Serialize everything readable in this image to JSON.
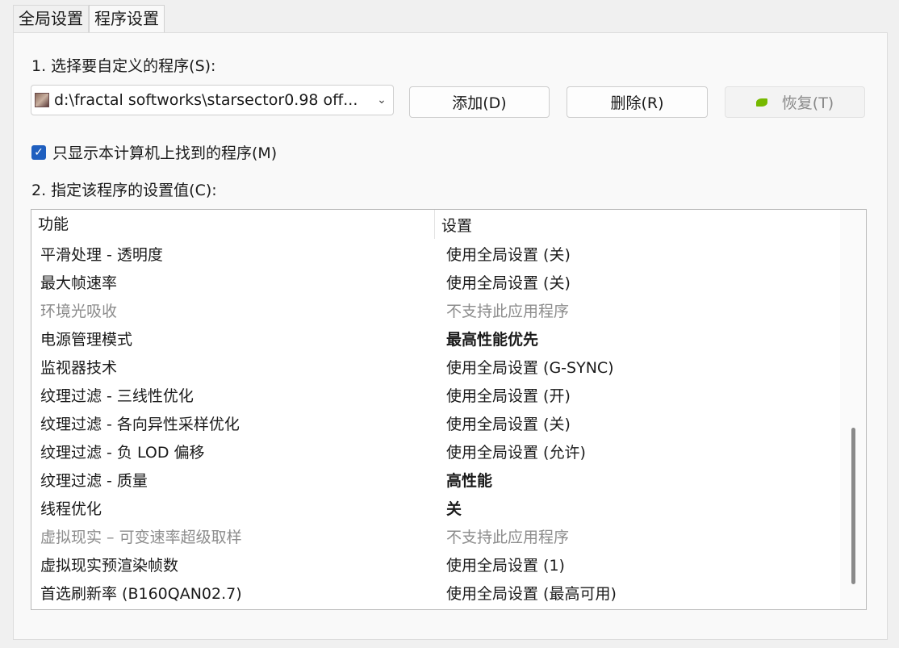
{
  "tabs": [
    {
      "label": "全局设置"
    },
    {
      "label": "程序设置"
    }
  ],
  "step1_label": "1. 选择要自定义的程序(S):",
  "program_select": {
    "value": "d:\\fractal softworks\\starsector0.98 off..."
  },
  "buttons": {
    "add": "添加(D)",
    "delete": "删除(R)",
    "restore": "恢复(T)"
  },
  "checkbox": {
    "label": "只显示本计算机上找到的程序(M)",
    "checked": true
  },
  "step2_label": "2. 指定该程序的设置值(C):",
  "table": {
    "headers": [
      "功能",
      "设置"
    ],
    "rows": [
      {
        "feature": "平滑处理 - 透明度",
        "setting": "使用全局设置 (关)",
        "style": "normal"
      },
      {
        "feature": "最大帧速率",
        "setting": "使用全局设置 (关)",
        "style": "normal"
      },
      {
        "feature": "环境光吸收",
        "setting": "不支持此应用程序",
        "style": "disabled"
      },
      {
        "feature": "电源管理模式",
        "setting": "最高性能优先",
        "style": "bold"
      },
      {
        "feature": "监视器技术",
        "setting": "使用全局设置 (G-SYNC)",
        "style": "normal"
      },
      {
        "feature": "纹理过滤 - 三线性优化",
        "setting": "使用全局设置 (开)",
        "style": "normal"
      },
      {
        "feature": "纹理过滤 - 各向异性采样优化",
        "setting": "使用全局设置 (关)",
        "style": "normal"
      },
      {
        "feature": "纹理过滤 - 负 LOD 偏移",
        "setting": "使用全局设置 (允许)",
        "style": "normal"
      },
      {
        "feature": "纹理过滤 - 质量",
        "setting": "高性能",
        "style": "bold"
      },
      {
        "feature": "线程优化",
        "setting": "关",
        "style": "bold"
      },
      {
        "feature": "虚拟现实 – 可变速率超级取样",
        "setting": "不支持此应用程序",
        "style": "disabled"
      },
      {
        "feature": "虚拟现实预渲染帧数",
        "setting": "使用全局设置 (1)",
        "style": "normal"
      },
      {
        "feature": "首选刷新率 (B160QAN02.7)",
        "setting": "使用全局设置 (最高可用)",
        "style": "normal"
      }
    ]
  },
  "icons": {
    "app": "program-icon",
    "dropdown": "chevron-down-icon",
    "restore": "nvidia-icon",
    "check": "checkmark-icon"
  },
  "colors": {
    "checkbox": "#1f5fbf",
    "nvidia": "#76b900",
    "disabled_text": "#8c8c8c"
  }
}
